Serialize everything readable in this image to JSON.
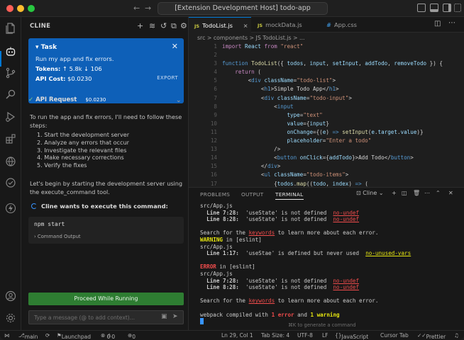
{
  "window": {
    "title": "[Extension Development Host] todo-app"
  },
  "activity_bar": {
    "icons": [
      "files-icon",
      "cline-icon",
      "source-control-icon",
      "search-icon",
      "run-debug-icon",
      "extensions-icon",
      "remote-icon",
      "flash-icon",
      "account-icon",
      "settings-gear-icon"
    ]
  },
  "cline": {
    "header": "CLINE",
    "task": {
      "label": "Task",
      "description": "Run my app and fix errors.",
      "tokens_label": "Tokens:",
      "tokens_up": "↑ 5.8k",
      "tokens_down": "↓ 106",
      "api_cost_label": "API Cost:",
      "api_cost": "$0.0230",
      "export": "EXPORT"
    },
    "api_request": {
      "label": "API Request",
      "cost": "$0.0230"
    },
    "intro": "To run the app and fix errors, I'll need to follow these steps:",
    "steps": [
      "1. Start the development server",
      "2. Analyze any errors that occur",
      "3. Investigate the relevant files",
      "4. Make necessary corrections",
      "5. Verify the fixes"
    ],
    "begin": "Let's begin by starting the development server using the execute_command tool.",
    "exec_label": "Cline wants to execute this command:",
    "command": "npm start",
    "command_output": "Command Output",
    "proceed": "Proceed While Running",
    "input_placeholder": "Type a message (@ to add context)..."
  },
  "editor": {
    "tabs": [
      {
        "label": "TodoList.js",
        "icon": "JS",
        "active": true
      },
      {
        "label": "mockData.js",
        "icon": "JS",
        "active": false
      },
      {
        "label": "App.css",
        "icon": "#",
        "active": false
      }
    ],
    "breadcrumb": "src > components > JS TodoList.js > ...",
    "line_numbers": [
      "1",
      "2",
      "3",
      "4",
      "5",
      "6",
      "7",
      "8",
      "9",
      "10",
      "11",
      "12",
      "13",
      "14",
      "15",
      "16",
      "17"
    ]
  },
  "terminal": {
    "tabs": [
      "PROBLEMS",
      "OUTPUT",
      "TERMINAL"
    ],
    "active_tab": "TERMINAL",
    "shell": "Cline",
    "hint": "⌘K to generate a command"
  },
  "status_bar": {
    "branch": "main",
    "launchpad": "Launchpad",
    "errors": "0",
    "warnings": "0",
    "ports": "0",
    "position": "Ln 29, Col 1",
    "tab_size": "Tab Size: 4",
    "encoding": "UTF-8",
    "eol": "LF",
    "language": "JavaScript",
    "cursor_tab": "Cursor Tab",
    "prettier": "Prettier"
  },
  "colors": {
    "accent": "#0078d4",
    "task_blue": "#0e60b8",
    "proceed_green": "#2e7d32"
  }
}
